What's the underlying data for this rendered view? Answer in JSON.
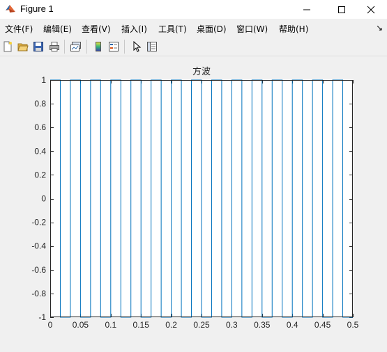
{
  "window": {
    "title": "Figure 1",
    "icon": "matlab-icon"
  },
  "window_controls": [
    "minimize-icon",
    "maximize-icon",
    "close-icon"
  ],
  "menu": {
    "items": [
      {
        "label": "文件(F)"
      },
      {
        "label": "编辑(E)"
      },
      {
        "label": "查看(V)"
      },
      {
        "label": "插入(I)"
      },
      {
        "label": "工具(T)"
      },
      {
        "label": "桌面(D)"
      },
      {
        "label": "窗口(W)"
      },
      {
        "label": "帮助(H)"
      }
    ],
    "overflow": "↘"
  },
  "toolbar": {
    "icons": [
      "new-figure-icon",
      "open-file-icon",
      "save-icon",
      "print-icon",
      "link-plot-icon",
      "insert-colorbar-icon",
      "insert-legend-icon",
      "edit-plot-icon",
      "property-inspector-icon"
    ]
  },
  "colors": {
    "line": "#0072bd",
    "axes_bg": "#ffffff",
    "figure_bg": "#f0f0f0",
    "axis": "#262626"
  },
  "chart_data": {
    "type": "line",
    "title": "方波",
    "xlabel": "",
    "ylabel": "",
    "xlim": [
      0,
      0.5
    ],
    "ylim": [
      -1,
      1
    ],
    "grid": false,
    "signal": {
      "shape": "square wave",
      "amplitude": 1,
      "period": 0.0333,
      "duty_cycle": 0.5,
      "start_level": 1,
      "cycles": 15
    },
    "xticks": [
      "0",
      "0.05",
      "0.1",
      "0.15",
      "0.2",
      "0.25",
      "0.3",
      "0.35",
      "0.4",
      "0.45",
      "0.5"
    ],
    "yticks": [
      "1",
      "0.8",
      "0.6",
      "0.4",
      "0.2",
      "0",
      "-0.2",
      "-0.4",
      "-0.6",
      "-0.8",
      "-1"
    ]
  }
}
